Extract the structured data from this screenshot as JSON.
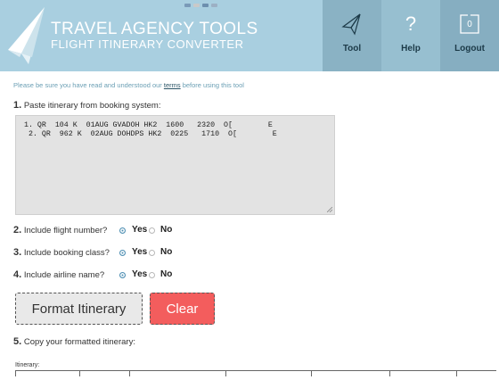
{
  "header": {
    "brand_title": "TRAVEL AGENCY TOOLS",
    "brand_subtitle": "FLIGHT ITINERARY CONVERTER",
    "languages": [
      {
        "name": "flag-1",
        "color": "#7a9ab8"
      },
      {
        "name": "flag-2",
        "color": "#c9c9c9"
      },
      {
        "name": "flag-3",
        "color": "#6d8fae"
      },
      {
        "name": "flag-4",
        "color": "#9cb0c4"
      }
    ],
    "nav": {
      "tool": "Tool",
      "help": "Help",
      "help_glyph": "?",
      "logout": "Logout",
      "logout_count": "0"
    }
  },
  "notice": {
    "before": "Please be sure you have read and understood our ",
    "link": "terms",
    "after": " before using this tool"
  },
  "step1": {
    "num": "1.",
    "label": " Paste itinerary from booking system:"
  },
  "itinerary": {
    "value": " 1. QR  104 K  01AUG GVADOH HK2  1600   2320  O[        E\n  2. QR  962 K  02AUG DOHDPS HK2  0225   1710  O[        E"
  },
  "options": [
    {
      "num": "2.",
      "label": " Include flight number?",
      "yes": "Yes",
      "no": "No",
      "selected": "yes"
    },
    {
      "num": "3.",
      "label": " Include booking class?",
      "yes": "Yes",
      "no": "No",
      "selected": "yes"
    },
    {
      "num": "4.",
      "label": " Include airline name?",
      "yes": "Yes",
      "no": "No",
      "selected": "yes"
    }
  ],
  "buttons": {
    "format": "Format Itinerary",
    "clear": "Clear"
  },
  "step5": {
    "num": "5.",
    "label": " Copy your formatted itinerary:"
  },
  "output": {
    "label": "Itinerary:"
  },
  "colors": {
    "header": "#a9cfe0",
    "accent": "#4e8fb3",
    "clear": "#f35d5d"
  }
}
